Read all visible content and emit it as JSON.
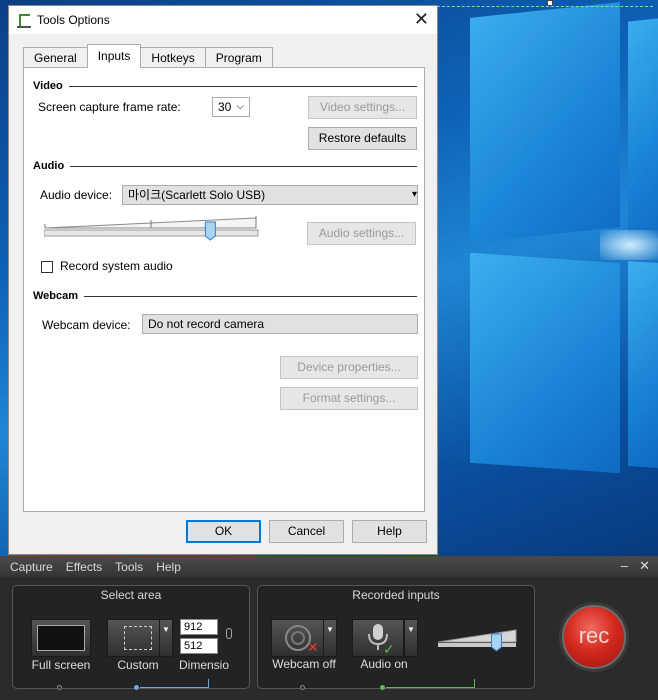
{
  "dialog": {
    "title": "Tools Options",
    "tabs": [
      "General",
      "Inputs",
      "Hotkeys",
      "Program"
    ],
    "active_tab": "Inputs",
    "video": {
      "heading": "Video",
      "frame_rate_label": "Screen capture frame rate:",
      "frame_rate_value": "30",
      "video_settings": "Video settings...",
      "restore_defaults": "Restore defaults"
    },
    "audio": {
      "heading": "Audio",
      "device_label": "Audio device:",
      "device_value": "마이크(Scarlett Solo USB)",
      "audio_settings": "Audio settings...",
      "level": 0.78,
      "record_system_label": "Record system audio",
      "record_system_checked": false
    },
    "webcam": {
      "heading": "Webcam",
      "device_label": "Webcam device:",
      "device_value": "Do not record camera",
      "device_properties": "Device properties...",
      "format_settings": "Format settings..."
    },
    "buttons": {
      "ok": "OK",
      "cancel": "Cancel",
      "help": "Help"
    }
  },
  "recorder": {
    "menu": [
      "Capture",
      "Effects",
      "Tools",
      "Help"
    ],
    "minimize": "–",
    "close": "✕",
    "select_area": {
      "title": "Select area",
      "full_screen": "Full screen",
      "custom": "Custom",
      "width": "912",
      "height": "512",
      "dimensions": "Dimensio"
    },
    "recorded_inputs": {
      "title": "Recorded inputs",
      "webcam": "Webcam off",
      "audio": "Audio on",
      "level": 0.75
    },
    "rec": "rec"
  },
  "colors": {
    "accent": "#0078d7",
    "rec_red": "#d42a20",
    "audio_on_green": "#55c04a"
  }
}
